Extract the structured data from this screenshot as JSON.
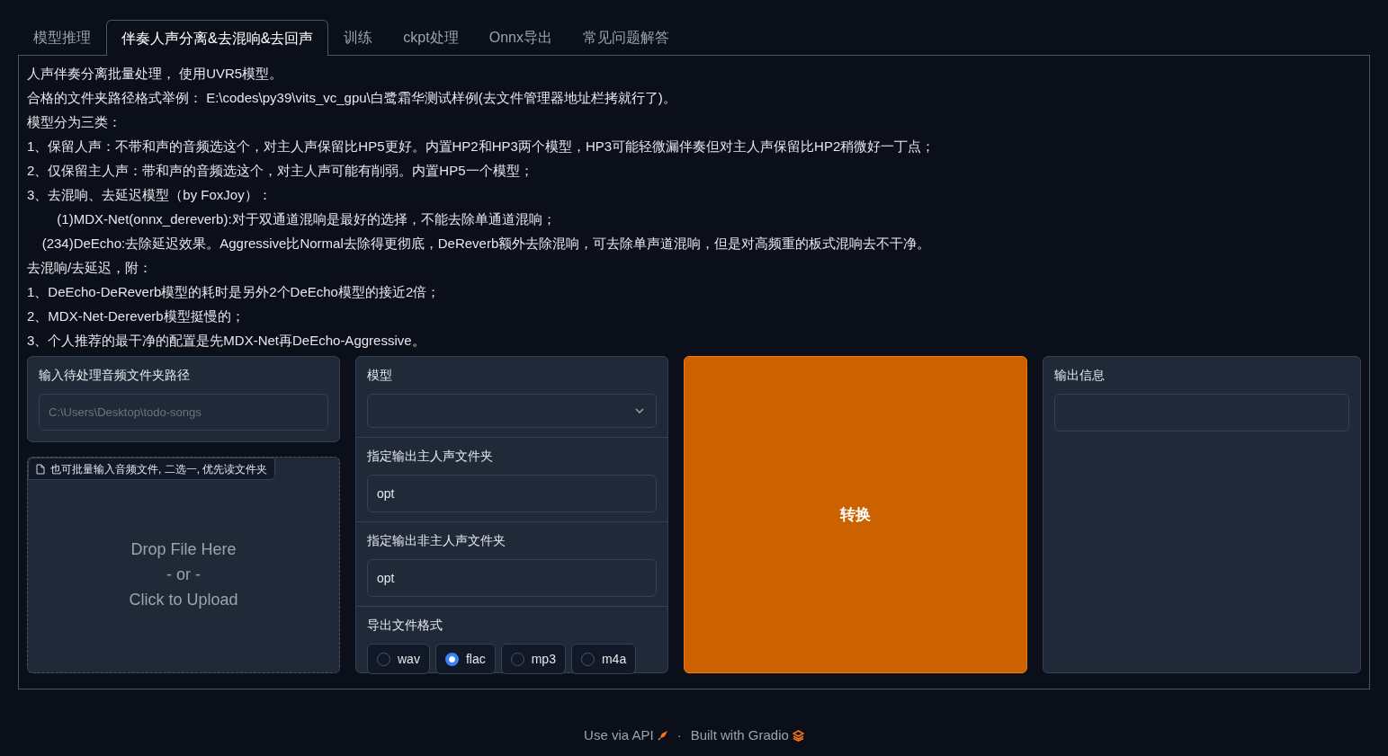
{
  "tabs": [
    {
      "label": "模型推理",
      "selected": false
    },
    {
      "label": "伴奏人声分离&去混响&去回声",
      "selected": true
    },
    {
      "label": "训练",
      "selected": false
    },
    {
      "label": "ckpt处理",
      "selected": false
    },
    {
      "label": "Onnx导出",
      "selected": false
    },
    {
      "label": "常见问题解答",
      "selected": false
    }
  ],
  "description": [
    "人声伴奏分离批量处理， 使用UVR5模型。",
    "合格的文件夹路径格式举例： E:\\codes\\py39\\vits_vc_gpu\\白鹭霜华测试样例(去文件管理器地址栏拷就行了)。",
    "模型分为三类：",
    "1、保留人声：不带和声的音频选这个，对主人声保留比HP5更好。内置HP2和HP3两个模型，HP3可能轻微漏伴奏但对主人声保留比HP2稍微好一丁点；",
    "2、仅保留主人声：带和声的音频选这个，对主人声可能有削弱。内置HP5一个模型；",
    "3、去混响、去延迟模型（by FoxJoy）：",
    "        (1)MDX-Net(onnx_dereverb):对于双通道混响是最好的选择，不能去除单通道混响；",
    "    (234)DeEcho:去除延迟效果。Aggressive比Normal去除得更彻底，DeReverb额外去除混响，可去除单声道混响，但是对高频重的板式混响去不干净。",
    "去混响/去延迟，附：",
    "1、DeEcho-DeReverb模型的耗时是另外2个DeEcho模型的接近2倍；",
    "2、MDX-Net-Dereverb模型挺慢的；",
    "3、个人推荐的最干净的配置是先MDX-Net再DeEcho-Aggressive。"
  ],
  "input_folder": {
    "label": "输入待处理音频文件夹路径",
    "placeholder": "C:\\Users\\Desktop\\todo-songs"
  },
  "file_upload": {
    "label": "也可批量输入音频文件, 二选一, 优先读文件夹",
    "drop_text": [
      "Drop File Here",
      "- or -",
      "Click to Upload"
    ]
  },
  "model": {
    "label": "模型"
  },
  "vocal_folder": {
    "label": "指定输出主人声文件夹",
    "value": "opt"
  },
  "other_folder": {
    "label": "指定输出非主人声文件夹",
    "value": "opt"
  },
  "format": {
    "label": "导出文件格式",
    "options": [
      {
        "label": "wav",
        "selected": false
      },
      {
        "label": "flac",
        "selected": true
      },
      {
        "label": "mp3",
        "selected": false
      },
      {
        "label": "m4a",
        "selected": false
      }
    ]
  },
  "convert_button": "转换",
  "output": {
    "label": "输出信息"
  },
  "footer": {
    "api_link": "Use via API",
    "separator": "·",
    "built_with": "Built with Gradio"
  }
}
